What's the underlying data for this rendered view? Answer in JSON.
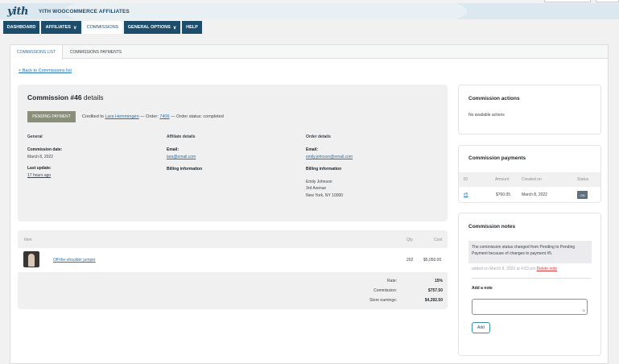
{
  "header": {
    "logo_text": "yith",
    "plugin_title": "YITH WOOCOMMERCE AFFILIATES"
  },
  "nav": {
    "tabs": [
      {
        "label": "DASHBOARD",
        "has_menu": false
      },
      {
        "label": "AFFILIATES",
        "has_menu": true
      },
      {
        "label": "COMMISSIONS",
        "has_menu": false,
        "active": true
      },
      {
        "label": "GENERAL OPTIONS",
        "has_menu": true
      },
      {
        "label": "HELP",
        "has_menu": false
      }
    ],
    "chevron_glyph": "∨"
  },
  "subtabs": [
    {
      "label": "COMMISSIONS LIST",
      "active": true
    },
    {
      "label": "COMMISSIONS PAYMENTS",
      "active": false
    }
  ],
  "back_link": "< Back to Commissions list",
  "details": {
    "title_prefix": "Commission #46",
    "title_suffix": " details",
    "status_badge": "PENDING PAYMENT",
    "credited_prefix": "Credited to ",
    "affiliate_name": "Lara Hemmingen",
    "order_sep": " — Order: ",
    "order_number": "7406",
    "order_status": " — Order status: completed",
    "general": {
      "heading": "General",
      "date_label": "Commission date:",
      "date_value": "March 8, 2022",
      "update_label": "Last update:",
      "update_value": "17 hours ago"
    },
    "affiliate": {
      "heading": "Affiliate details",
      "email_label": "Email:",
      "email_value": "lara@email.com",
      "billing_label": "Billing information"
    },
    "order": {
      "heading": "Order details",
      "email_label": "Email:",
      "email_value": "emily.johnson@email.com",
      "billing_label": "Billing information",
      "billing_name": "Emily Johnson",
      "billing_line1": "3rd Avenue",
      "billing_line2": "New York, NY 10000"
    }
  },
  "items": {
    "headers": {
      "item": "Item",
      "qty": "Qty",
      "cost": "Cost"
    },
    "rows": [
      {
        "name": "Off-the-shoulder jumper",
        "qty": "202",
        "cost": "$5,050.00"
      }
    ],
    "totals": [
      {
        "label": "Rate:",
        "value": "15%"
      },
      {
        "label": "Commission:",
        "value": "$757.50"
      },
      {
        "label": "Store earnings:",
        "value": "$4,292.50"
      }
    ]
  },
  "actions": {
    "title": "Commission actions",
    "empty_text": "No available actions"
  },
  "payments": {
    "title": "Commission payments",
    "headers": {
      "id": "ID",
      "amount": "Amount",
      "created": "Created on",
      "status": "Status"
    },
    "rows": [
      {
        "id": "#5",
        "amount": "$760.05",
        "created": "March 8, 2022",
        "status": "on"
      }
    ]
  },
  "notes": {
    "title": "Commission notes",
    "note_text": "The commission status changed from Pending to Pending Payment because of changes to payment #5.",
    "meta_prefix": "added on March 8, 2022 at 4:03 pm ",
    "delete_label": "Delete note",
    "add_label": "Add a note",
    "input_value": "",
    "add_button": "Add"
  },
  "colors": {
    "brand": "#1e4d6b",
    "header_bg": "#dce8ef",
    "badge_bg": "#8a8f7a",
    "link": "#2271b1",
    "delete": "#d63638"
  }
}
